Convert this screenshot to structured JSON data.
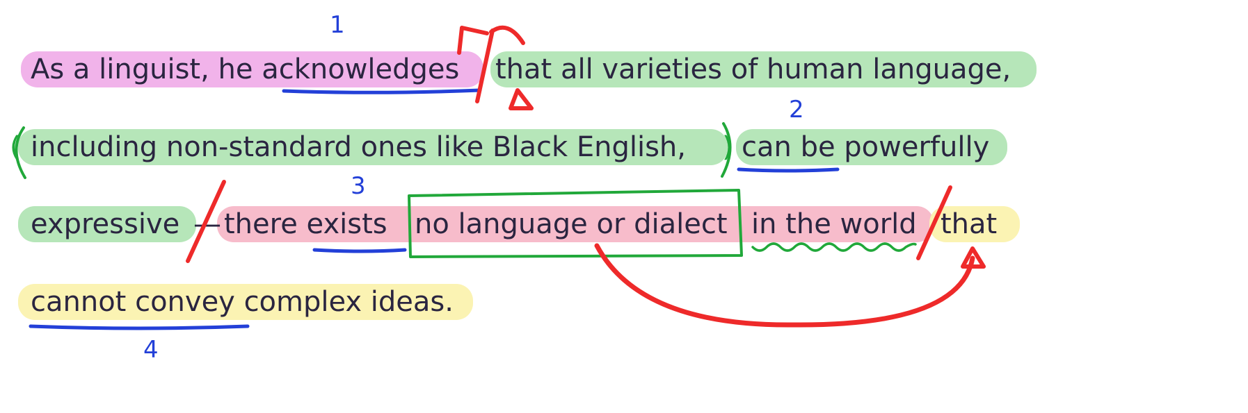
{
  "lines": [
    {
      "segments": [
        {
          "text": "As a linguist, he acknowledges",
          "highlight": "pink"
        },
        {
          "text": "that all varieties of human language,",
          "highlight": "green"
        }
      ]
    },
    {
      "segments": [
        {
          "text": "(",
          "highlight": "none"
        },
        {
          "text": "including non-standard ones like Black English,",
          "highlight": "green"
        },
        {
          "text": ")",
          "highlight": "none"
        },
        {
          "text": "can be powerfully",
          "highlight": "green"
        }
      ]
    },
    {
      "segments": [
        {
          "text": "expressive",
          "highlight": "green"
        },
        {
          "text": "—",
          "highlight": "none"
        },
        {
          "text": "there exists",
          "highlight": "red"
        },
        {
          "text": "no language or dialect",
          "highlight": "red"
        },
        {
          "text": "in the world",
          "highlight": "red"
        },
        {
          "text": "that",
          "highlight": "yellow"
        }
      ]
    },
    {
      "segments": [
        {
          "text": "cannot convey complex ideas.",
          "highlight": "yellow"
        }
      ]
    }
  ],
  "annotations": {
    "numbers": [
      "1",
      "2",
      "3",
      "4"
    ]
  },
  "colors": {
    "pink": "#f1b3ea",
    "green": "#b6e6b9",
    "red": "#f7bccb",
    "yellow": "#fbf3b3",
    "ink_blue": "#2340d8",
    "ink_red": "#ee2a2a",
    "ink_green": "#21a83a",
    "text": "#2a2540"
  }
}
